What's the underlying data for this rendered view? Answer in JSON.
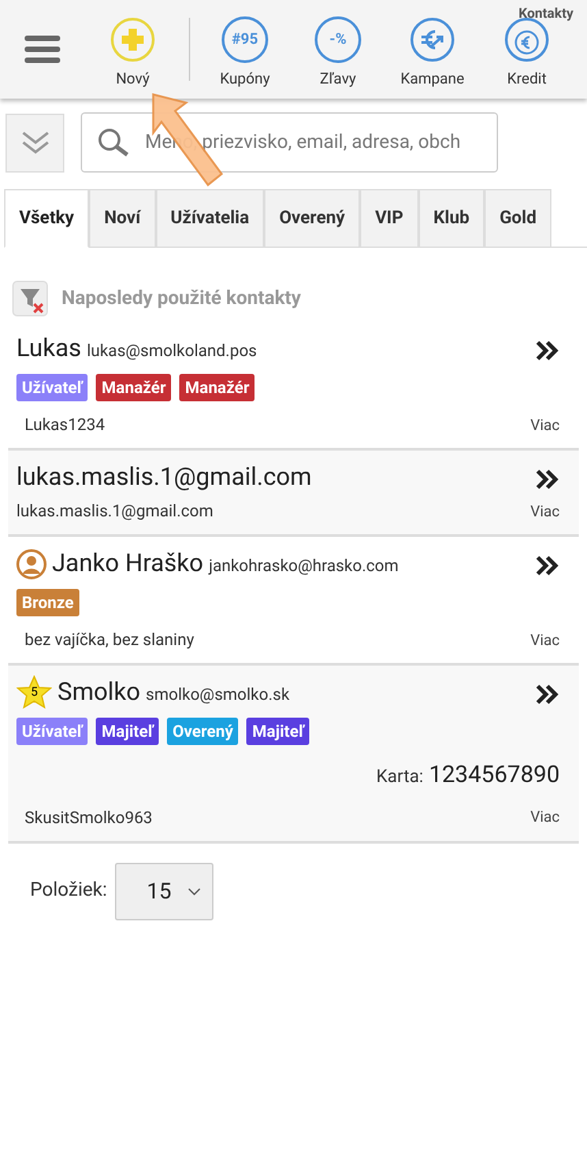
{
  "page_title": "Kontakty",
  "toolbar": [
    {
      "label": "Nový",
      "kind": "new"
    },
    {
      "label": "Kupóny",
      "kind": "coupon",
      "icon_text": "#95"
    },
    {
      "label": "Zľavy",
      "kind": "discount",
      "icon_text": "-%"
    },
    {
      "label": "Kampane",
      "kind": "campaign"
    },
    {
      "label": "Kredit",
      "kind": "credit"
    }
  ],
  "search": {
    "placeholder": "Meno, priezvisko, email, adresa, obch"
  },
  "tabs": [
    {
      "label": "Všetky",
      "selected": true
    },
    {
      "label": "Noví",
      "selected": false
    },
    {
      "label": "Užívatelia",
      "selected": false
    },
    {
      "label": "Overený",
      "selected": false
    },
    {
      "label": "VIP",
      "selected": false
    },
    {
      "label": "Klub",
      "selected": false
    },
    {
      "label": "Gold",
      "selected": false
    }
  ],
  "recent_heading": "Naposledy použité kontakty",
  "contacts": [
    {
      "kind": "plain",
      "name": "Lukas",
      "email": "lukas@smolkoland.pos",
      "tags": [
        {
          "label": "Užívateľ",
          "color": "#8b80f9"
        },
        {
          "label": "Manažér",
          "color": "#c62f35"
        },
        {
          "label": "Manažér",
          "color": "#c62f35"
        }
      ],
      "note": "Lukas1234",
      "more": "Viac"
    },
    {
      "kind": "plain",
      "name": "lukas.maslis.1@gmail.com",
      "subtitle": "lukas.maslis.1@gmail.com",
      "more": "Viac"
    },
    {
      "kind": "person",
      "name": "Janko Hraško",
      "email": "jankohrasko@hrasko.com",
      "tags": [
        {
          "label": "Bronze",
          "color": "#c98038"
        }
      ],
      "note": "bez vajíčka, bez slaniny",
      "more": "Viac"
    },
    {
      "kind": "rated",
      "star_text": "5",
      "name": "Smolko",
      "email": "smolko@smolko.sk",
      "tags": [
        {
          "label": "Užívateľ",
          "color": "#8b80f9"
        },
        {
          "label": "Majiteľ",
          "color": "#5a3fe0"
        },
        {
          "label": "Overený",
          "color": "#1ba2e0"
        },
        {
          "label": "Majiteľ",
          "color": "#5a3fe0"
        }
      ],
      "card_label": "Karta:",
      "card_number": "1234567890",
      "note": "SkusitSmolko963",
      "more": "Viac"
    }
  ],
  "pagination": {
    "label": "Položiek:",
    "value": "15"
  }
}
